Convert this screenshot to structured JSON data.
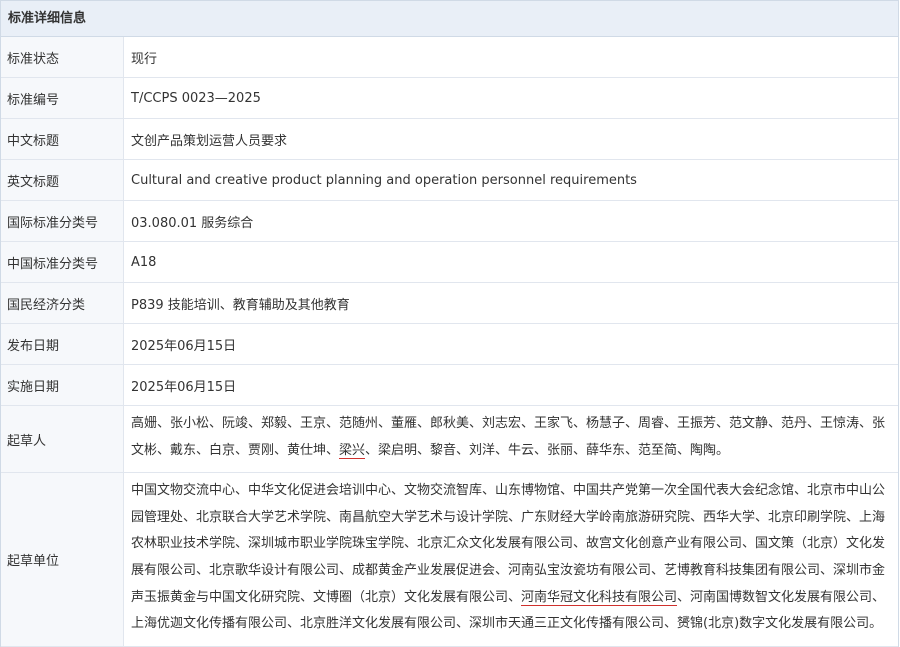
{
  "panel": {
    "title": "标准详细信息"
  },
  "rows": [
    {
      "label": "标准状态",
      "value": "现行"
    },
    {
      "label": "标准编号",
      "value": "T/CCPS 0023—2025"
    },
    {
      "label": "中文标题",
      "value": "文创产品策划运营人员要求"
    },
    {
      "label": "英文标题",
      "value": "Cultural and creative product planning and operation personnel requirements"
    },
    {
      "label": "国际标准分类号",
      "value": "03.080.01 服务综合"
    },
    {
      "label": "中国标准分类号",
      "value": "A18"
    },
    {
      "label": "国民经济分类",
      "value": "P839 技能培训、教育辅助及其他教育"
    },
    {
      "label": "发布日期",
      "value": "2025年06月15日"
    },
    {
      "label": "实施日期",
      "value": "2025年06月15日"
    }
  ],
  "drafters": {
    "label": "起草人",
    "before": "高姗、张小松、阮竣、郑毅、王京、范随州、董雁、郎秋美、刘志宏、王家飞、杨慧子、周睿、王振芳、范文静、范丹、王惊涛、张文彬、戴东、白京、贾刚、黄仕坤、",
    "highlight": "梁兴",
    "after": "、梁启明、黎音、刘洋、牛云、张丽、薛华东、范至简、陶陶。"
  },
  "units": {
    "label": "起草单位",
    "before": "中国文物交流中心、中华文化促进会培训中心、文物交流智库、山东博物馆、中国共产党第一次全国代表大会纪念馆、北京市中山公园管理处、北京联合大学艺术学院、南昌航空大学艺术与设计学院、广东财经大学岭南旅游研究院、西华大学、北京印刷学院、上海农林职业技术学院、深圳城市职业学院珠宝学院、北京汇众文化发展有限公司、故宫文化创意产业有限公司、国文策（北京）文化发展有限公司、北京歌华设计有限公司、成都黄金产业发展促进会、河南弘宝汝瓷坊有限公司、艺博教育科技集团有限公司、深圳市金声玉振黄金与中国文化研究院、文博圈（北京）文化发展有限公司、",
    "highlight": "河南华冠文化科技有限公司",
    "after": "、河南国博数智文化发展有限公司、上海优迦文化传播有限公司、北京胜洋文化发展有限公司、深圳市天通三正文化传播有限公司、赟锦(北京)数字文化发展有限公司。"
  }
}
